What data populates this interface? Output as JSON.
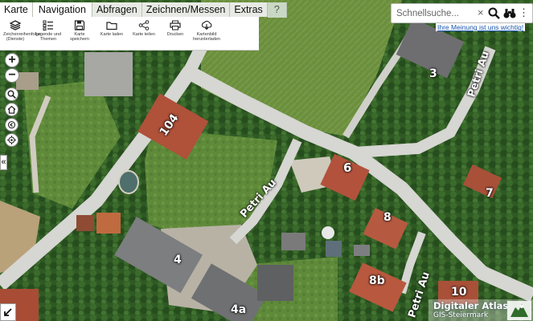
{
  "menu": {
    "tabs": [
      {
        "label": "Karte",
        "active": true
      },
      {
        "label": "Navigation",
        "active": true
      },
      {
        "label": "Abfragen",
        "active": false
      },
      {
        "label": "Zeichnen/Messen",
        "active": false
      },
      {
        "label": "Extras",
        "active": false
      },
      {
        "label": "?",
        "active": false
      }
    ]
  },
  "ribbon": {
    "buttons": [
      {
        "label": "Zeichenreihenfolge (Dienste)",
        "icon": "layers-icon"
      },
      {
        "label": "Legende und Themen",
        "icon": "legend-icon"
      },
      {
        "label": "Karte speichern",
        "icon": "save-icon"
      },
      {
        "label": "Karte laden",
        "icon": "folder-icon"
      },
      {
        "label": "Karte teilen",
        "icon": "share-icon"
      },
      {
        "label": "Drucken",
        "icon": "print-icon"
      },
      {
        "label": "Kartenbild herunterladen",
        "icon": "download-icon"
      }
    ]
  },
  "search": {
    "placeholder": "Schnellsuche...",
    "value": "",
    "clear_symbol": "×",
    "hint_link": "Ihre Meinung ist uns wichtig!"
  },
  "controls": {
    "zoom_in": "+",
    "zoom_out": "−",
    "collapse": "«"
  },
  "map": {
    "labels": [
      "104",
      "6",
      "8",
      "8b",
      "4",
      "4a",
      "3",
      "7",
      "10",
      "Petri Au",
      "Petri Au",
      "Petri Au"
    ]
  },
  "logo": {
    "line1": "Digitaler Atlas",
    "line2": "GIS-Steiermark"
  },
  "colors": {
    "menu_bg": "#e8ebe5",
    "tab_active": "#ffffff",
    "help_tab": "#c9d8c3",
    "link": "#1a56b0"
  }
}
